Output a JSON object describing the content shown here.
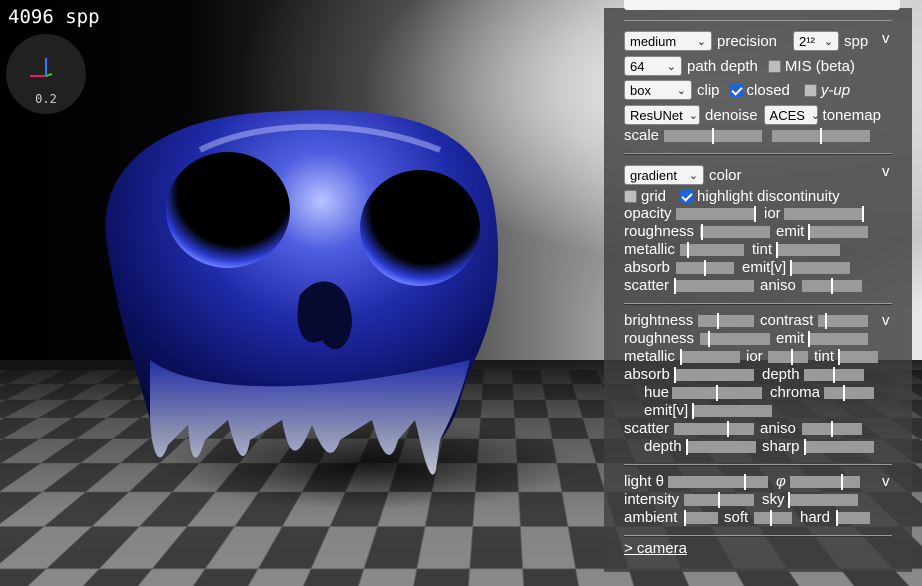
{
  "viewport": {
    "spp_label": "4096 spp",
    "gizmo_scale": "0.2"
  },
  "render": {
    "precision": {
      "value": "medium",
      "label": "precision"
    },
    "spp": {
      "value": "2¹²",
      "label": "spp"
    },
    "path_depth": {
      "value": "64",
      "label": "path depth"
    },
    "mis": {
      "label": "MIS (beta)",
      "checked": false
    },
    "clip": {
      "value": "box",
      "label": "clip"
    },
    "closed": {
      "label": "closed",
      "checked": true
    },
    "y_up": {
      "label": "y-up",
      "checked": false
    },
    "denoise": {
      "value": "ResUNet",
      "label": "denoise"
    },
    "tonemap": {
      "value": "ACES",
      "label": "tonemap"
    },
    "scale": {
      "label": "scale",
      "values": [
        0.5,
        0.5
      ]
    },
    "collapse": "v"
  },
  "color": {
    "mode": {
      "value": "gradient",
      "label": "color"
    },
    "grid": {
      "label": "grid",
      "checked": false
    },
    "highlight": {
      "label": "highlight discontinuity",
      "checked": true
    },
    "collapse": "v",
    "sliders": [
      {
        "label": "opacity",
        "value": 1.0
      },
      {
        "label": "ior",
        "value": 1.0
      },
      {
        "label": "roughness",
        "value": 0.02
      },
      {
        "label": "emit",
        "value": 0.0
      },
      {
        "label": "metallic",
        "value": 0.12
      },
      {
        "label": "tint",
        "value": 0.0
      },
      {
        "label": "absorb",
        "value": 0.5
      },
      {
        "label": "emit[v]",
        "value": 0.0
      },
      {
        "label": "scatter",
        "value": 0.0
      },
      {
        "label": "aniso",
        "value": 0.5
      }
    ]
  },
  "material": {
    "collapse": "v",
    "sliders": [
      {
        "label": "brightness",
        "value": 0.35
      },
      {
        "label": "contrast",
        "value": 0.15
      },
      {
        "label": "roughness",
        "value": 0.12
      },
      {
        "label": "emit",
        "value": 0.0
      },
      {
        "label": "metallic",
        "value": 0.0
      },
      {
        "label": "ior",
        "value": 0.6
      },
      {
        "label": "tint",
        "value": 0.0
      },
      {
        "label": "absorb",
        "value": 0.0
      },
      {
        "label": "depth",
        "value": 0.5
      },
      {
        "label": "hue",
        "value": 0.5
      },
      {
        "label": "chroma",
        "value": 0.4
      },
      {
        "label": "emit[v]",
        "value": 0.0
      },
      {
        "label": "scatter",
        "value": 0.68
      },
      {
        "label": "aniso",
        "value": 0.5
      },
      {
        "label": "depth",
        "value": 0.0
      },
      {
        "label": "sharp",
        "value": 0.0
      }
    ]
  },
  "light": {
    "collapse": "v",
    "sliders": [
      {
        "label": "light θ",
        "value": 0.78
      },
      {
        "label": "φ",
        "value": 0.75
      },
      {
        "label": "intensity",
        "value": 0.5
      },
      {
        "label": "sky",
        "value": 0.0
      },
      {
        "label": "ambient",
        "value": 0.0
      },
      {
        "label": "soft",
        "value": 0.45
      },
      {
        "label": "hard",
        "value": 0.0
      }
    ]
  },
  "camera_link": "> camera"
}
